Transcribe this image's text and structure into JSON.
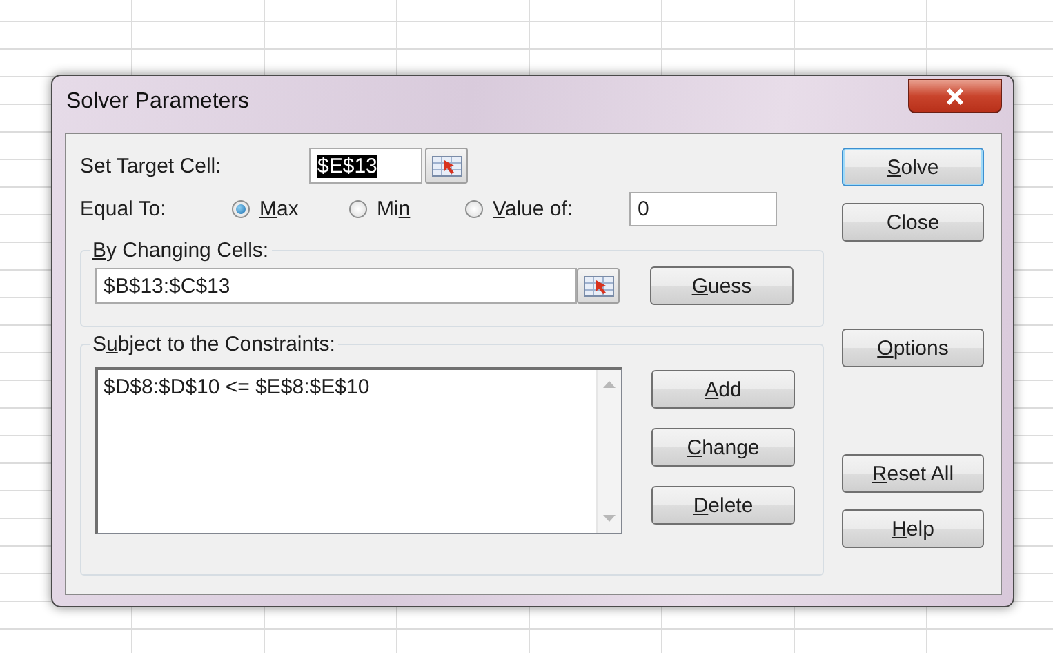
{
  "window": {
    "title": "Solver Parameters"
  },
  "target_cell": {
    "label": "Set Target Cell:",
    "value": "$E$13",
    "value_selected": true
  },
  "equal_to": {
    "label": "Equal To:",
    "options": [
      {
        "label": {
          "key": "M",
          "post": "ax"
        },
        "selected": true
      },
      {
        "label": {
          "pre": "Mi",
          "key": "n"
        },
        "selected": false
      },
      {
        "label": {
          "key": "V",
          "post": "alue of:"
        },
        "selected": false
      }
    ],
    "value_of": "0"
  },
  "changing_cells": {
    "label": {
      "key": "B",
      "post": "y Changing Cells:"
    },
    "value": "$B$13:$C$13",
    "button": {
      "key": "G",
      "post": "uess"
    }
  },
  "constraints": {
    "label": {
      "pre": "S",
      "key": "u",
      "post": "bject to the Constraints:"
    },
    "items": [
      {
        "text": "$D$8:$D$10 <= $E$8:$E$10",
        "selected": false
      }
    ],
    "buttons": [
      {
        "key": "A",
        "post": "dd"
      },
      {
        "key": "C",
        "post": "hange"
      },
      {
        "key": "D",
        "post": "elete"
      }
    ]
  },
  "side_buttons": [
    {
      "label": {
        "key": "S",
        "post": "olve"
      },
      "default": true
    },
    {
      "label": "Close",
      "default": false
    },
    {
      "label": {
        "key": "O",
        "post": "ptions"
      },
      "default": false
    },
    {
      "label": {
        "key": "R",
        "post": "eset All"
      },
      "default": false
    },
    {
      "label": {
        "key": "H",
        "post": "elp"
      },
      "default": false
    }
  ]
}
